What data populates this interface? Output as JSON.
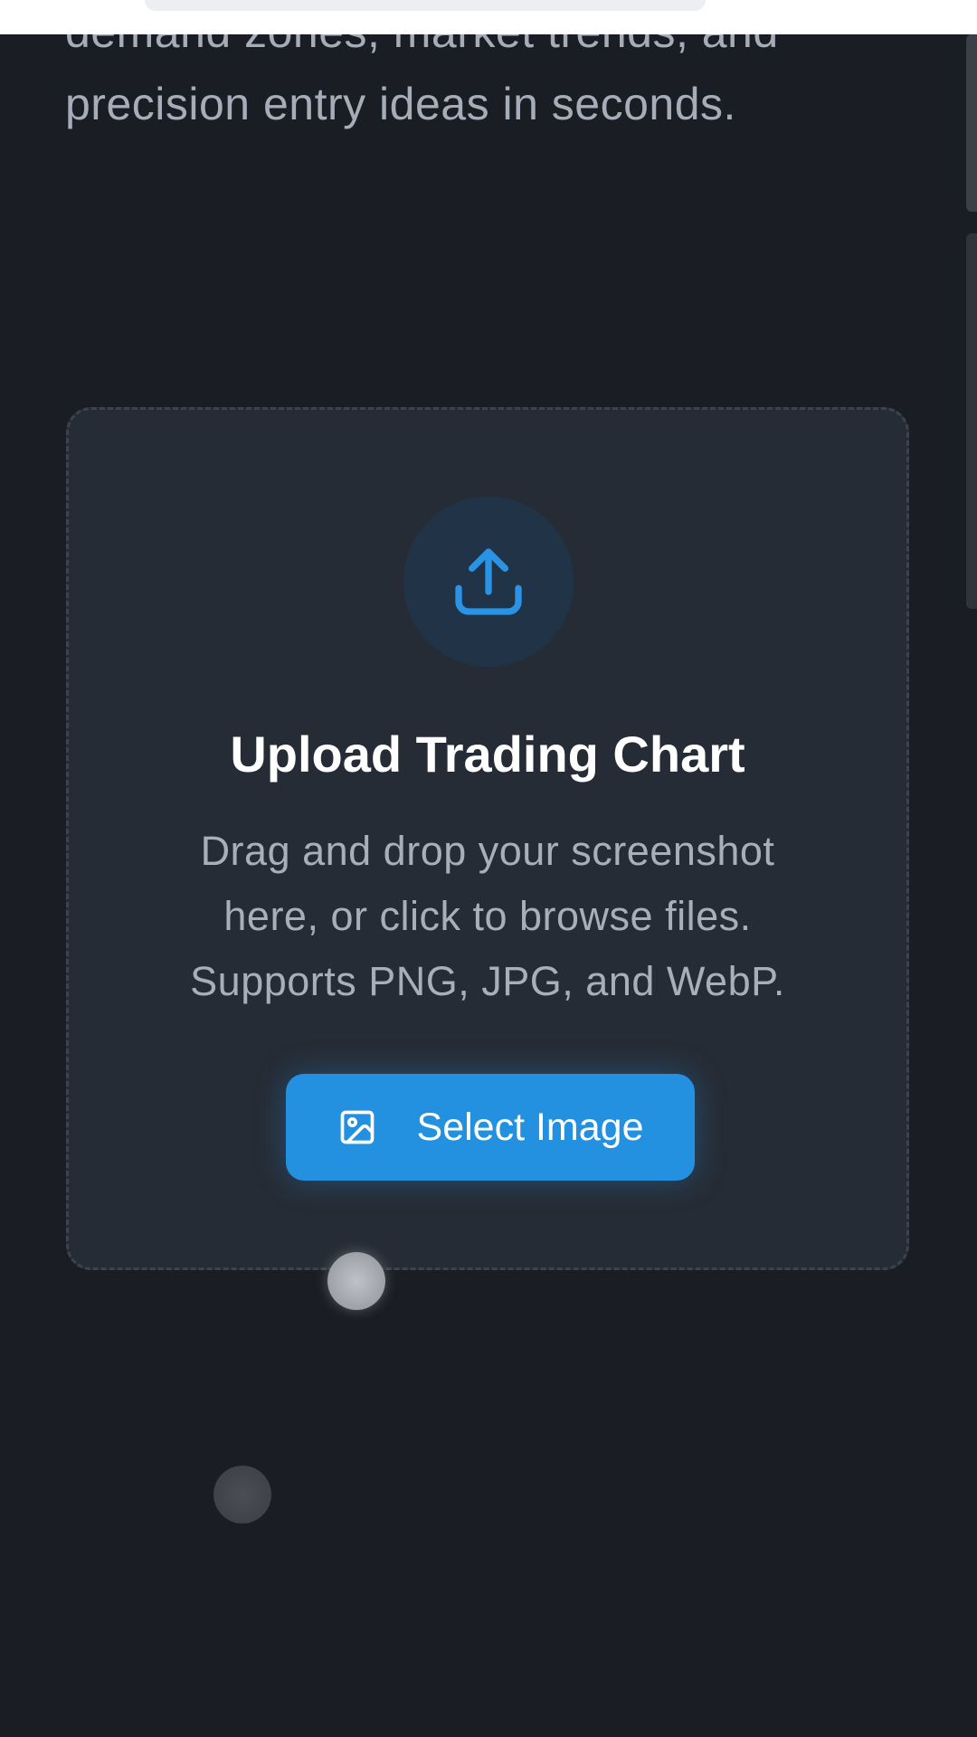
{
  "intro": {
    "clipped_line": "demand zones, market trends, and",
    "last_line": "precision entry ideas in seconds."
  },
  "upload": {
    "icon": "upload-icon",
    "title": "Upload Trading Chart",
    "description_lines": [
      "Drag and drop your screenshot",
      "here, or click to browse files.",
      "Supports PNG, JPG, and WebP."
    ],
    "button": {
      "icon": "image-icon",
      "label": "Select Image"
    }
  },
  "colors": {
    "background": "#1a1d24",
    "card": "#262c35",
    "accent": "#2490e0",
    "title": "#ffffff",
    "muted_text": "#a8afba"
  }
}
